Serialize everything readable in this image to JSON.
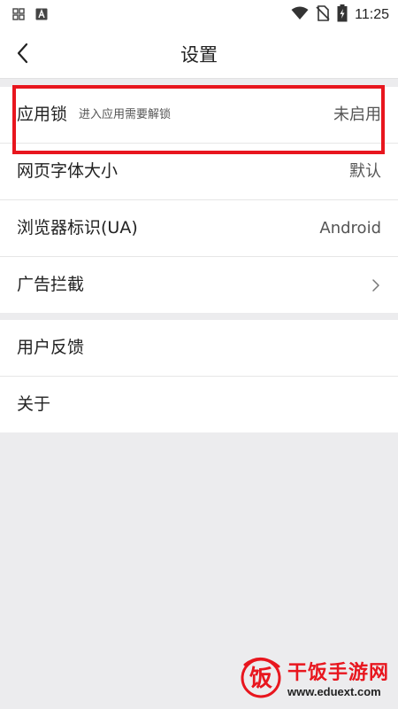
{
  "status_bar": {
    "time": "11:25",
    "left_icons": [
      "grid-icon",
      "a-icon"
    ],
    "right_icons": [
      "wifi-icon",
      "no-sim-icon",
      "battery-icon"
    ]
  },
  "header": {
    "title": "设置",
    "back_icon": "back-arrow-icon"
  },
  "groups": [
    {
      "rows": [
        {
          "label": "应用锁",
          "desc": "进入应用需要解锁",
          "value": "未启用"
        },
        {
          "label": "网页字体大小",
          "value": "默认"
        },
        {
          "label": "浏览器标识(UA)",
          "value": "Android"
        },
        {
          "label": "广告拦截",
          "icon": "chevron-right-icon"
        }
      ]
    },
    {
      "rows": [
        {
          "label": "用户反馈"
        },
        {
          "label": "关于"
        }
      ]
    }
  ],
  "highlight_color": "#E8161E",
  "watermark": {
    "logo_text": "饭",
    "name": "干饭手游网",
    "url": "www.eduext.com"
  }
}
